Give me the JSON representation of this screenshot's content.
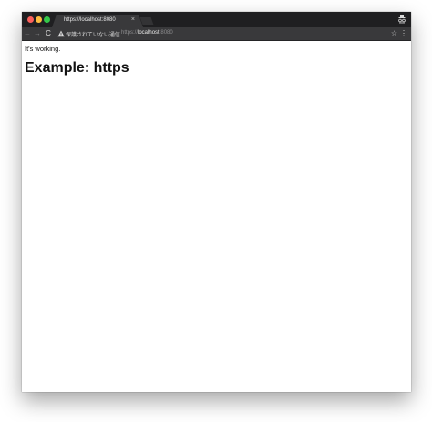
{
  "tab": {
    "title": "https://localhost:8080",
    "close_glyph": "×"
  },
  "toolbar": {
    "back_glyph": "←",
    "forward_glyph": "→",
    "reload_glyph": "C",
    "security_label": "保護されていない通信",
    "url": {
      "scheme": "https://",
      "host": "localhost",
      "port": ":8080"
    },
    "star_glyph": "☆",
    "menu_glyph": "⋮"
  },
  "page": {
    "status": "It's working.",
    "heading": "Example: https"
  },
  "colors": {
    "tabstrip": "#1f1f21",
    "toolbar": "#39393b",
    "traffic_close": "#fc605b",
    "traffic_min": "#fdbc40",
    "traffic_max": "#34c84a"
  },
  "icons": [
    "close-window-icon",
    "minimize-window-icon",
    "maximize-window-icon",
    "incognito-icon",
    "warning-icon",
    "star-icon",
    "menu-icon"
  ]
}
